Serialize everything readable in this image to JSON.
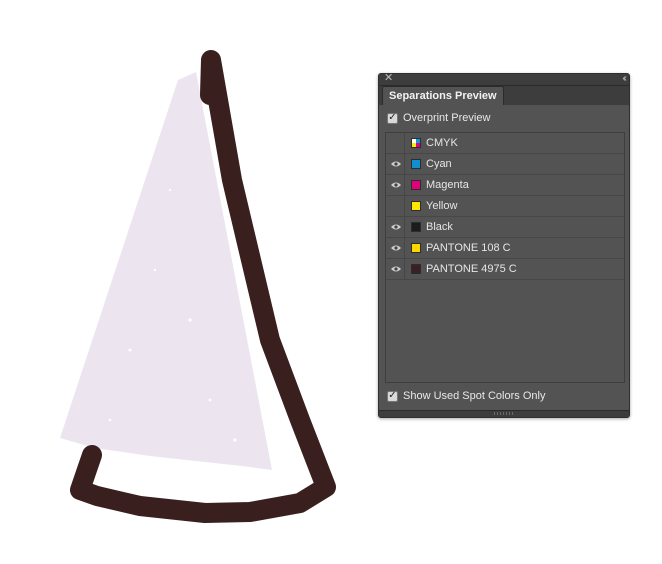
{
  "artwork": {
    "fill_color": "#ece4ee",
    "stroke_color": "#3a1f1f"
  },
  "panel": {
    "tab_label": "Separations Preview",
    "overprint_preview": {
      "label": "Overprint Preview",
      "checked": true
    },
    "show_used_spot": {
      "label": "Show Used Spot Colors Only",
      "checked": true
    },
    "separations": [
      {
        "name": "CMYK",
        "visible": false,
        "color": "cmyk"
      },
      {
        "name": "Cyan",
        "visible": true,
        "color": "#0f8fd0"
      },
      {
        "name": "Magenta",
        "visible": true,
        "color": "#e0007a"
      },
      {
        "name": "Yellow",
        "visible": false,
        "color": "#ffe600"
      },
      {
        "name": "Black",
        "visible": true,
        "color": "#1c1c1c"
      },
      {
        "name": "PANTONE 108 C",
        "visible": true,
        "color": "#ffd600"
      },
      {
        "name": "PANTONE 4975 C",
        "visible": true,
        "color": "#3c1f22"
      }
    ]
  }
}
